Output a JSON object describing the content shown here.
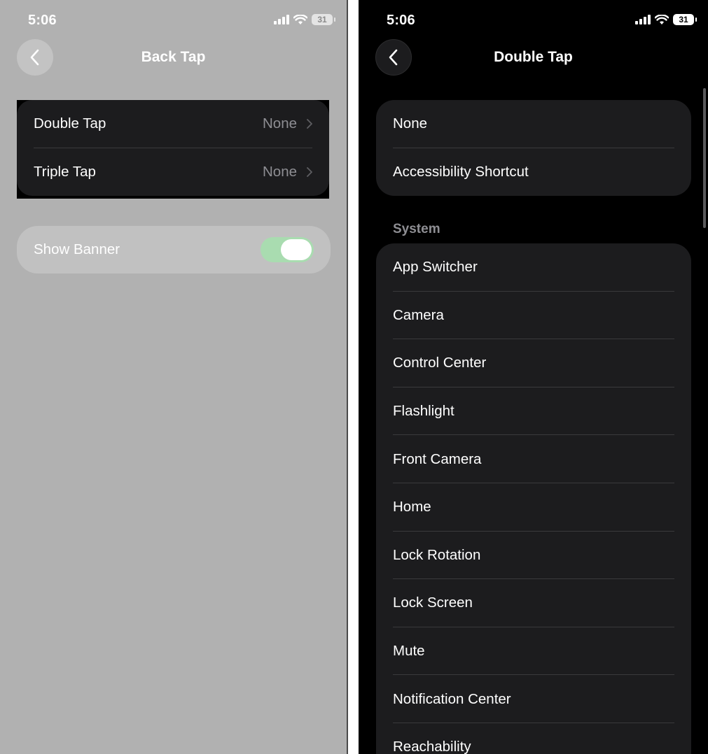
{
  "left": {
    "status": {
      "time": "5:06",
      "battery": "31"
    },
    "nav": {
      "title": "Back Tap"
    },
    "tap_rows": [
      {
        "label": "Double Tap",
        "value": "None"
      },
      {
        "label": "Triple Tap",
        "value": "None"
      }
    ],
    "banner": {
      "label": "Show Banner",
      "enabled": true
    }
  },
  "right": {
    "status": {
      "time": "5:06",
      "battery": "31"
    },
    "nav": {
      "title": "Double Tap"
    },
    "group1": [
      "None",
      "Accessibility Shortcut"
    ],
    "section_header": "System",
    "system_items": [
      "App Switcher",
      "Camera",
      "Control Center",
      "Flashlight",
      "Front Camera",
      "Home",
      "Lock Rotation",
      "Lock Screen",
      "Mute",
      "Notification Center",
      "Reachability"
    ]
  },
  "colors": {
    "dimmed_background": "#b1b1b1",
    "cell_background": "#1c1c1e",
    "secondary_text": "#8e8e93",
    "toggle_on_dimmed": "#a9dcb0"
  }
}
